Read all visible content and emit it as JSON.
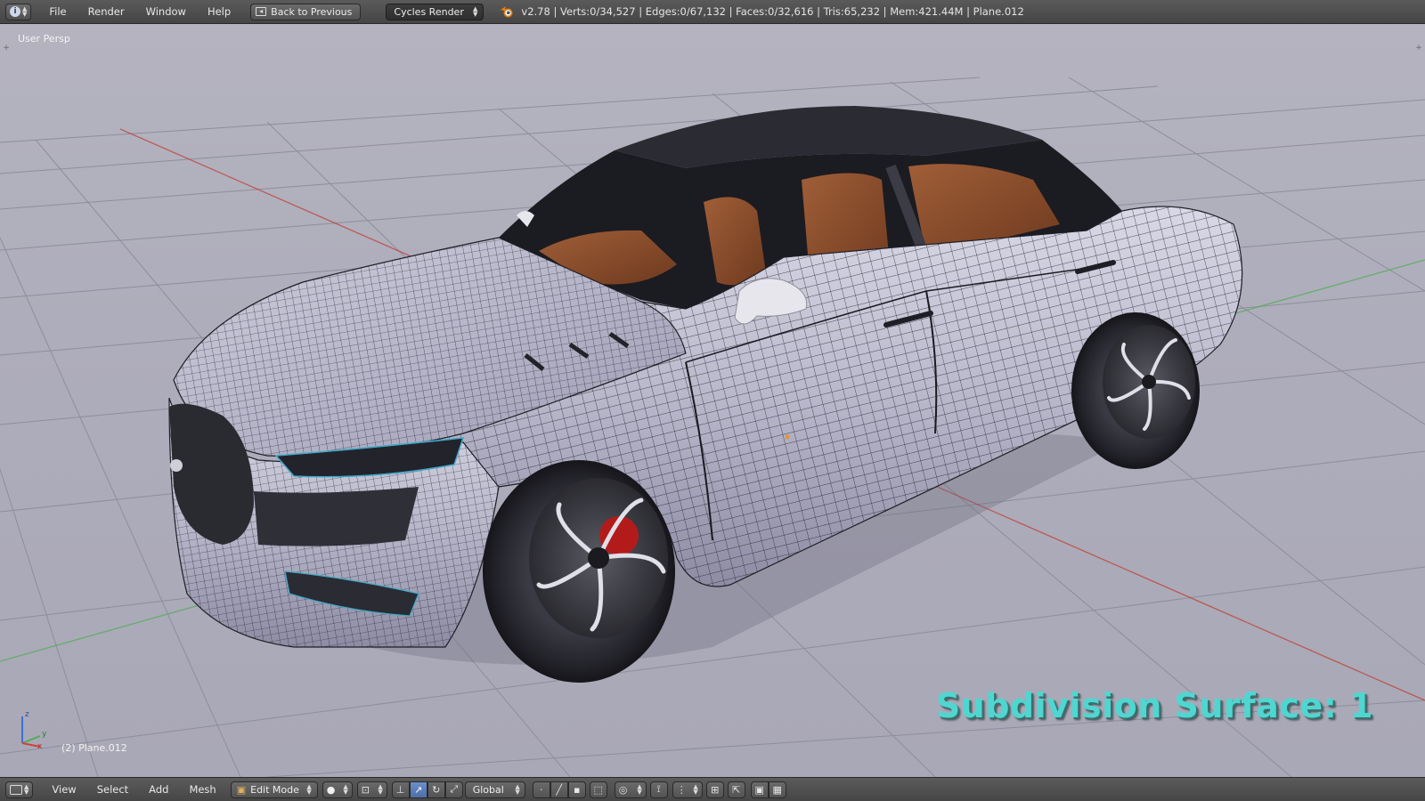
{
  "header": {
    "editor_type_icon": "info-icon",
    "menus": [
      "File",
      "Render",
      "Window",
      "Help"
    ],
    "back_button": "Back to Previous",
    "render_engine": "Cycles Render",
    "stats": "v2.78 | Verts:0/34,527 | Edges:0/67,132 | Faces:0/32,616 | Tris:65,232 | Mem:421.44M | Plane.012"
  },
  "viewport": {
    "view_name": "User Persp",
    "active_object": "(2) Plane.012",
    "overlay_text": "Subdivision Surface: 1",
    "axis_labels": [
      "z",
      "y",
      "x"
    ]
  },
  "footer": {
    "editor_type_icon": "3d-view-icon",
    "menus": [
      "View",
      "Select",
      "Add",
      "Mesh"
    ],
    "mode": "Edit Mode",
    "transform_orientation": "Global"
  },
  "colors": {
    "overlay_text": "#4fd6d1",
    "x_axis": "#c0392b",
    "y_axis": "#4caf50",
    "viewport_bg": "#aeadbb"
  }
}
